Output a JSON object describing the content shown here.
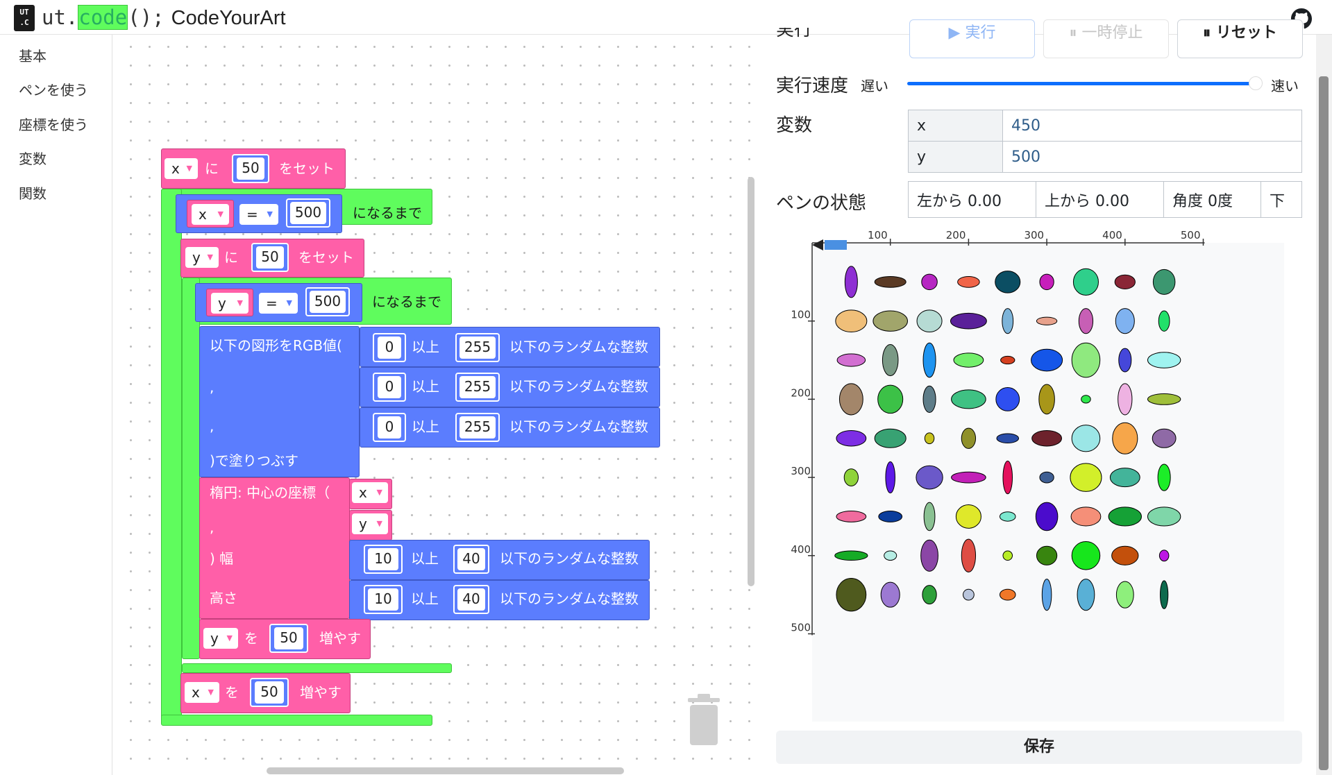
{
  "header": {
    "logo_line1": "UT",
    "logo_line2": ".C",
    "brand_prefix": "ut.",
    "brand_code": "code",
    "brand_suffix": "();",
    "brand_sub": "CodeYourArt",
    "github_icon": "github-icon"
  },
  "sidebar": {
    "categories": [
      "基本",
      "ペンを使う",
      "座標を使う",
      "変数",
      "関数"
    ]
  },
  "blocks": {
    "set_x": {
      "var": "x",
      "ni": "に",
      "value": "50",
      "suffix": "をセット"
    },
    "until_x": {
      "var": "x",
      "op": "=",
      "value": "500",
      "suffix": "になるまで"
    },
    "set_y": {
      "var": "y",
      "ni": "に",
      "value": "50",
      "suffix": "をセット"
    },
    "until_y": {
      "var": "y",
      "op": "=",
      "value": "500",
      "suffix": "になるまで"
    },
    "fill": {
      "label1": "以下の図形をRGB値(",
      "comma1": ",",
      "comma2": ",",
      "label_end": ")で塗りつぶす",
      "rand": [
        {
          "min": "0",
          "ijou": "以上",
          "max": "255",
          "suffix": "以下のランダムな整数"
        },
        {
          "min": "0",
          "ijou": "以上",
          "max": "255",
          "suffix": "以下のランダムな整数"
        },
        {
          "min": "0",
          "ijou": "以上",
          "max": "255",
          "suffix": "以下のランダムな整数"
        }
      ]
    },
    "ellipse": {
      "label1": "楕円: 中心の座標（",
      "comma": ",",
      "label_w": ") 幅",
      "label_h": "高さ",
      "cx": "x",
      "cy": "y",
      "rand": [
        {
          "min": "10",
          "ijou": "以上",
          "max": "40",
          "suffix": "以下のランダムな整数"
        },
        {
          "min": "10",
          "ijou": "以上",
          "max": "40",
          "suffix": "以下のランダムな整数"
        }
      ]
    },
    "inc_y": {
      "var": "y",
      "wo": "を",
      "value": "50",
      "suffix": "増やす"
    },
    "inc_x": {
      "var": "x",
      "wo": "を",
      "value": "50",
      "suffix": "増やす"
    }
  },
  "controls": {
    "run_label_cut": "実行",
    "run_button": "▶ 実行",
    "pause_button": "⏸ 一時停止",
    "reset_button": "⏸ リセット",
    "speed_label": "実行速度",
    "slow": "遅い",
    "fast": "速い",
    "speed_value": 1.0
  },
  "variables": {
    "title": "変数",
    "rows": [
      {
        "name": "x",
        "value": "450"
      },
      {
        "name": "y",
        "value": "500"
      }
    ]
  },
  "pen": {
    "title": "ペンの状態",
    "left": "左から 0.00",
    "top": "上から 0.00",
    "angle": "角度 0度",
    "state": "下"
  },
  "canvas": {
    "x_ticks": [
      "100",
      "200",
      "300",
      "400",
      "500"
    ],
    "y_ticks": [
      "100",
      "200",
      "300",
      "400",
      "500"
    ],
    "colors": [
      "#8e2fd3",
      "#5a3a24",
      "#b627c2",
      "#f06448",
      "#0b4e63",
      "#c71fbb",
      "#2fcf8b",
      "#8a2636",
      "#3c9770",
      "#f0bf79",
      "#a1a56b",
      "#b6dbd4",
      "#5a2099",
      "#7db4d9",
      "#e8a28c",
      "#c75fb5",
      "#7fb2f0",
      "#22e06a",
      "#d26fd1",
      "#7a9985",
      "#1e94f0",
      "#72ef6a",
      "#d54020",
      "#1556e8",
      "#8fe97f",
      "#4547da",
      "#9ff3f0",
      "#a3866a",
      "#3cc147",
      "#5e7d89",
      "#3fc183",
      "#2e4ff0",
      "#a89619",
      "#2fe84c",
      "#eeb2e2",
      "#9fbf3a",
      "#7d2ee4",
      "#38a273",
      "#c8c21e",
      "#8f902a",
      "#2a4da8",
      "#6d222c",
      "#9be6e6",
      "#f6a64a",
      "#8f6aa6",
      "#8fd33a",
      "#5d19e7",
      "#6b59c9",
      "#c220b7",
      "#e4115c",
      "#3f5f93",
      "#d2ef2a",
      "#43b49a",
      "#1ced28",
      "#f06b9e",
      "#0a3d9c",
      "#8ac192",
      "#dfe82a",
      "#7be8cf",
      "#4b0ccc",
      "#f58f78",
      "#15a136",
      "#7fd6a9",
      "#16ab26",
      "#b6ede4",
      "#8b46a6",
      "#de4d44",
      "#b7ed27",
      "#38850f",
      "#17e61c",
      "#c3500c",
      "#bd17e4",
      "#4f5a1e",
      "#9c79d2",
      "#2ea03a",
      "#b9c5dc",
      "#f07728",
      "#5ba3e6",
      "#59b0d6",
      "#8eef7c",
      "#0e6a4d"
    ],
    "sizes": [
      [
        16,
        40
      ],
      [
        40,
        14
      ],
      [
        20,
        20
      ],
      [
        28,
        14
      ],
      [
        32,
        28
      ],
      [
        18,
        20
      ],
      [
        32,
        34
      ],
      [
        26,
        18
      ],
      [
        28,
        32
      ],
      [
        40,
        28
      ],
      [
        44,
        26
      ],
      [
        32,
        28
      ],
      [
        46,
        20
      ],
      [
        14,
        32
      ],
      [
        26,
        10
      ],
      [
        18,
        32
      ],
      [
        24,
        32
      ],
      [
        14,
        26
      ],
      [
        36,
        16
      ],
      [
        20,
        40
      ],
      [
        16,
        44
      ],
      [
        38,
        18
      ],
      [
        18,
        10
      ],
      [
        40,
        28
      ],
      [
        36,
        44
      ],
      [
        16,
        30
      ],
      [
        42,
        20
      ],
      [
        30,
        40
      ],
      [
        32,
        36
      ],
      [
        16,
        34
      ],
      [
        44,
        24
      ],
      [
        30,
        30
      ],
      [
        20,
        38
      ],
      [
        12,
        10
      ],
      [
        18,
        40
      ],
      [
        42,
        14
      ],
      [
        38,
        20
      ],
      [
        40,
        24
      ],
      [
        12,
        14
      ],
      [
        18,
        26
      ],
      [
        28,
        12
      ],
      [
        38,
        20
      ],
      [
        36,
        34
      ],
      [
        32,
        40
      ],
      [
        30,
        24
      ],
      [
        18,
        22
      ],
      [
        12,
        40
      ],
      [
        34,
        30
      ],
      [
        44,
        14
      ],
      [
        12,
        42
      ],
      [
        18,
        14
      ],
      [
        40,
        36
      ],
      [
        38,
        24
      ],
      [
        16,
        34
      ],
      [
        38,
        14
      ],
      [
        30,
        14
      ],
      [
        14,
        36
      ],
      [
        32,
        30
      ],
      [
        20,
        12
      ],
      [
        28,
        36
      ],
      [
        38,
        24
      ],
      [
        42,
        24
      ],
      [
        42,
        24
      ],
      [
        42,
        12
      ],
      [
        16,
        12
      ],
      [
        22,
        40
      ],
      [
        18,
        42
      ],
      [
        12,
        12
      ],
      [
        26,
        24
      ],
      [
        36,
        36
      ],
      [
        34,
        24
      ],
      [
        12,
        14
      ],
      [
        38,
        42
      ],
      [
        24,
        32
      ],
      [
        18,
        24
      ],
      [
        14,
        14
      ],
      [
        20,
        14
      ],
      [
        12,
        40
      ],
      [
        22,
        40
      ],
      [
        22,
        34
      ],
      [
        10,
        36
      ]
    ]
  },
  "save_button": "保存"
}
